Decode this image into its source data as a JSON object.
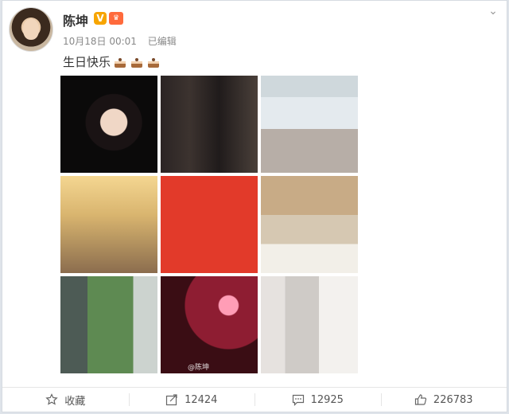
{
  "post": {
    "username": "陈坤",
    "badge_v": "V",
    "timestamp": "10月18日 00:01",
    "edited": "已编辑",
    "text": "生日快乐",
    "emoji": [
      "cake-icon",
      "cake-icon",
      "cake-icon"
    ],
    "watermark": "@陈坤"
  },
  "actions": {
    "favorite_label": "收藏",
    "repost_count": "12424",
    "comment_count": "12925",
    "like_count": "226783"
  }
}
